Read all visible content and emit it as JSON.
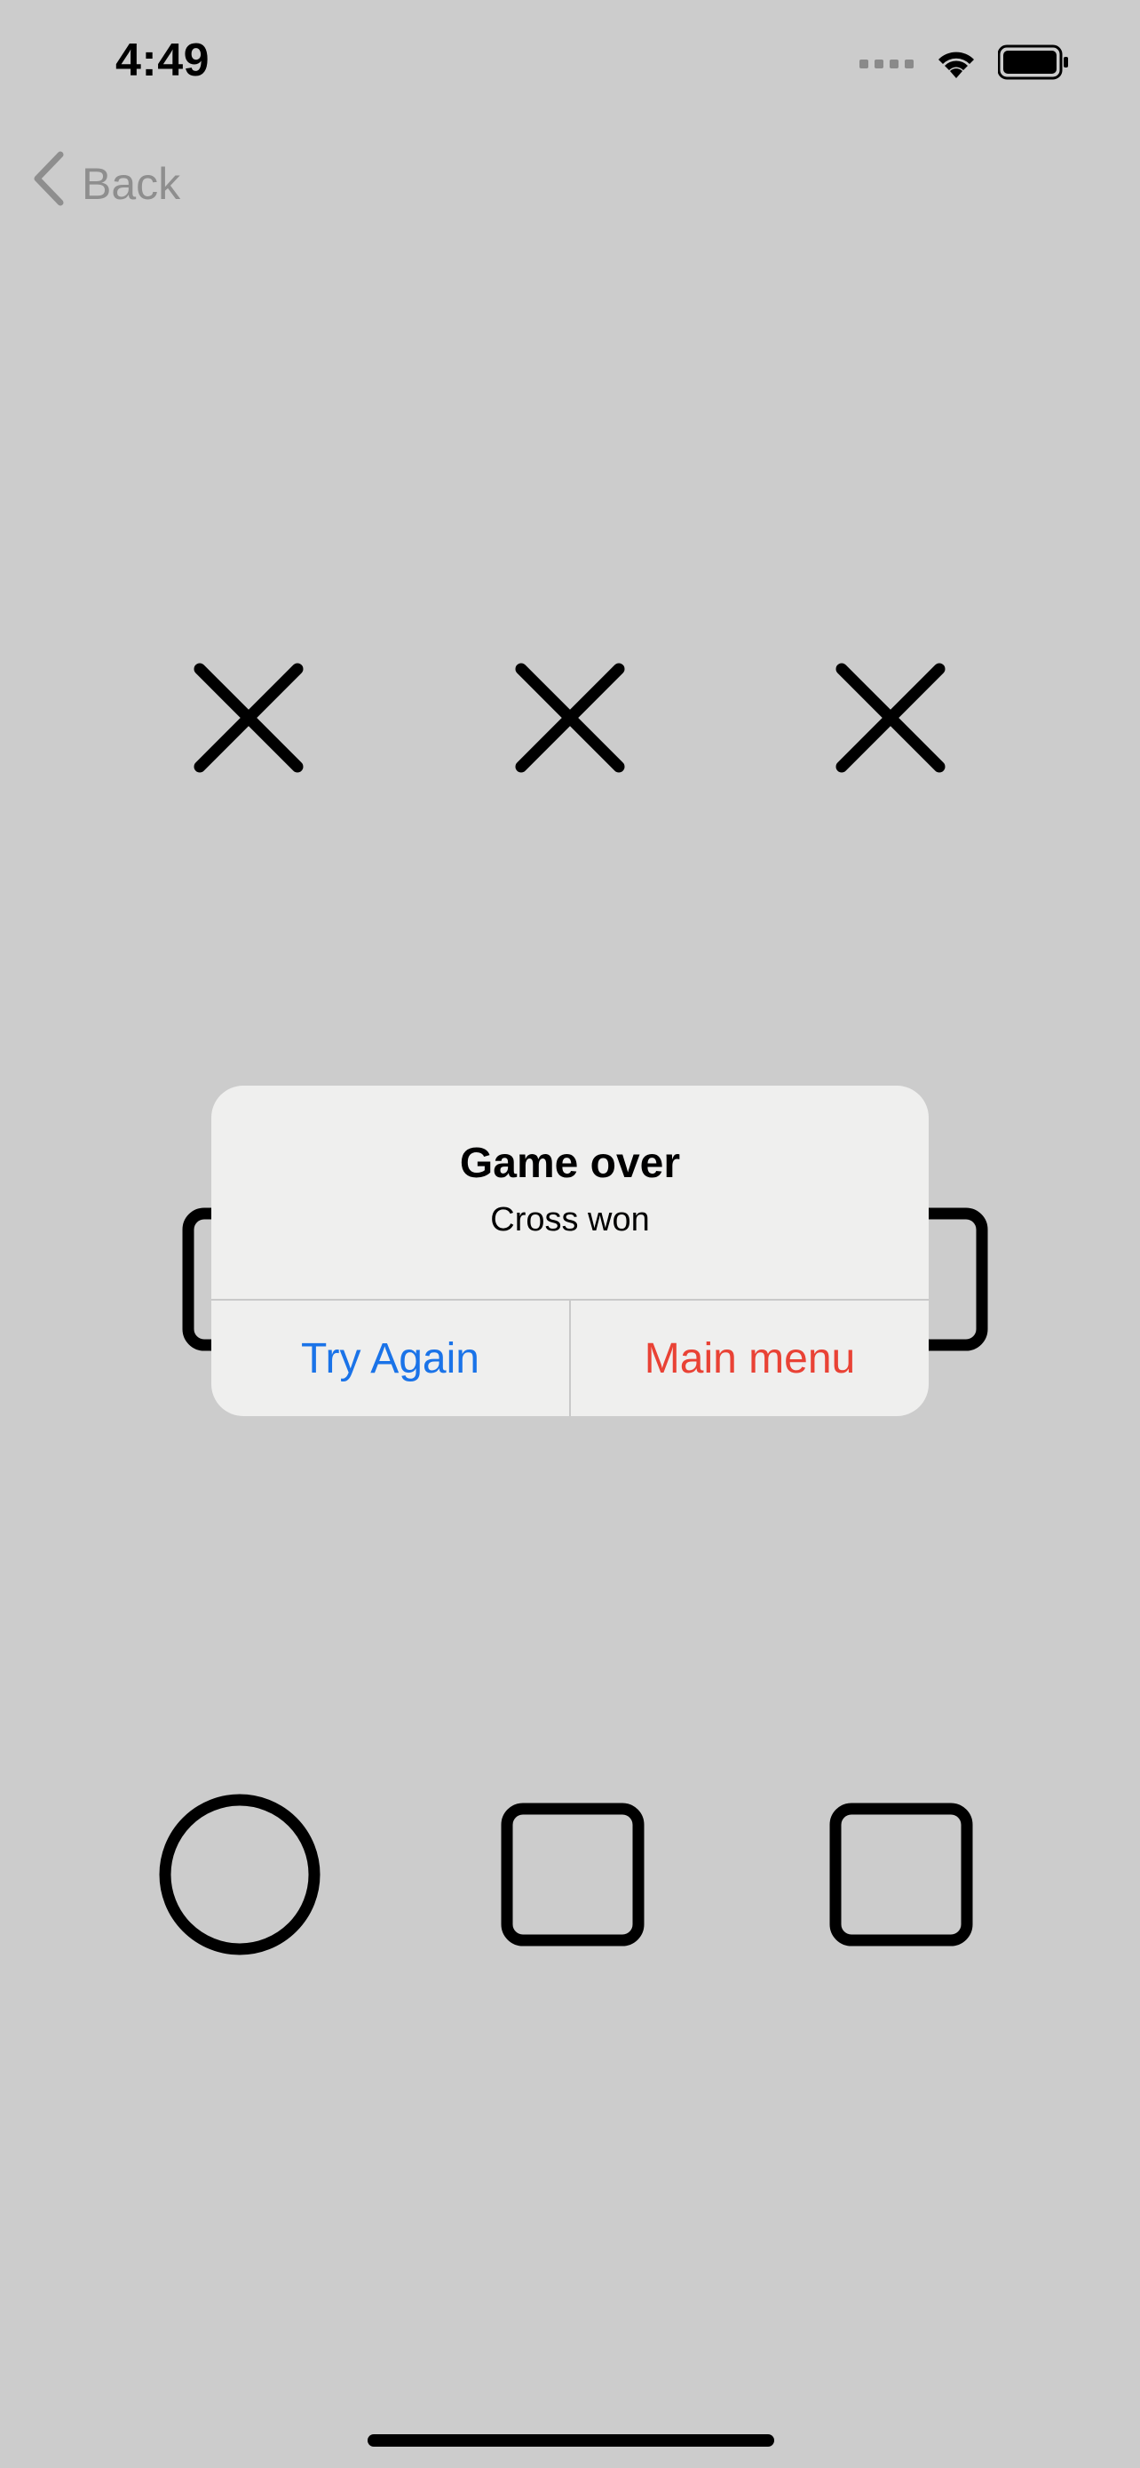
{
  "status_bar": {
    "time": "4:49",
    "icons": [
      "signal-icon",
      "wifi-icon",
      "battery-icon"
    ]
  },
  "nav": {
    "back_label": "Back",
    "back_icon": "chevron-left-icon"
  },
  "board": {
    "rows": [
      [
        "X",
        "X",
        "X"
      ],
      [
        "empty",
        "",
        "empty"
      ],
      [
        "O",
        "empty",
        "empty"
      ]
    ]
  },
  "alert": {
    "title": "Game over",
    "message": "Cross won",
    "buttons": {
      "try_again": "Try Again",
      "main_menu": "Main menu"
    }
  },
  "colors": {
    "background": "#cccccc",
    "alert_bg": "#efefee",
    "try_again": "#1a73e8",
    "main_menu": "#e94235",
    "back": "#8e8e8e",
    "marks": "#000000"
  }
}
